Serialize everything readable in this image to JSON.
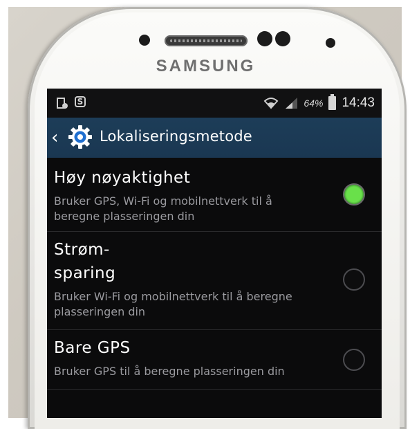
{
  "device": {
    "brand": "SAMSUNG"
  },
  "status_bar": {
    "left_icons": [
      "sim-card-icon",
      "s-app-icon"
    ],
    "wifi": "wifi-icon",
    "signal": "signal-icon",
    "battery_percent": "64%",
    "time": "14:43"
  },
  "action_bar": {
    "back_icon": "back-chevron-icon",
    "gear_icon": "gear-icon",
    "title": "Lokaliseringsmetode"
  },
  "options": [
    {
      "title_line1": "Høy nøyaktighet",
      "title_line2": "",
      "description_line1": "Bruker GPS, Wi-Fi og mobilnettverk til å",
      "description_line2": "beregne plasseringen din",
      "selected": true
    },
    {
      "title_line1": "Strøm-",
      "title_line2": "sparing",
      "description_line1": "Bruker Wi-Fi og mobilnettverk til å beregne",
      "description_line2": "plasseringen din",
      "selected": false
    },
    {
      "title_line1": "Bare GPS",
      "title_line2": "",
      "description_line1": "Bruker GPS til å beregne plasseringen din",
      "description_line2": "",
      "selected": false
    }
  ],
  "colors": {
    "action_bar": "#1d3d58",
    "radio_selected": "#69e04a",
    "screen_bg": "#0b0b0c"
  }
}
